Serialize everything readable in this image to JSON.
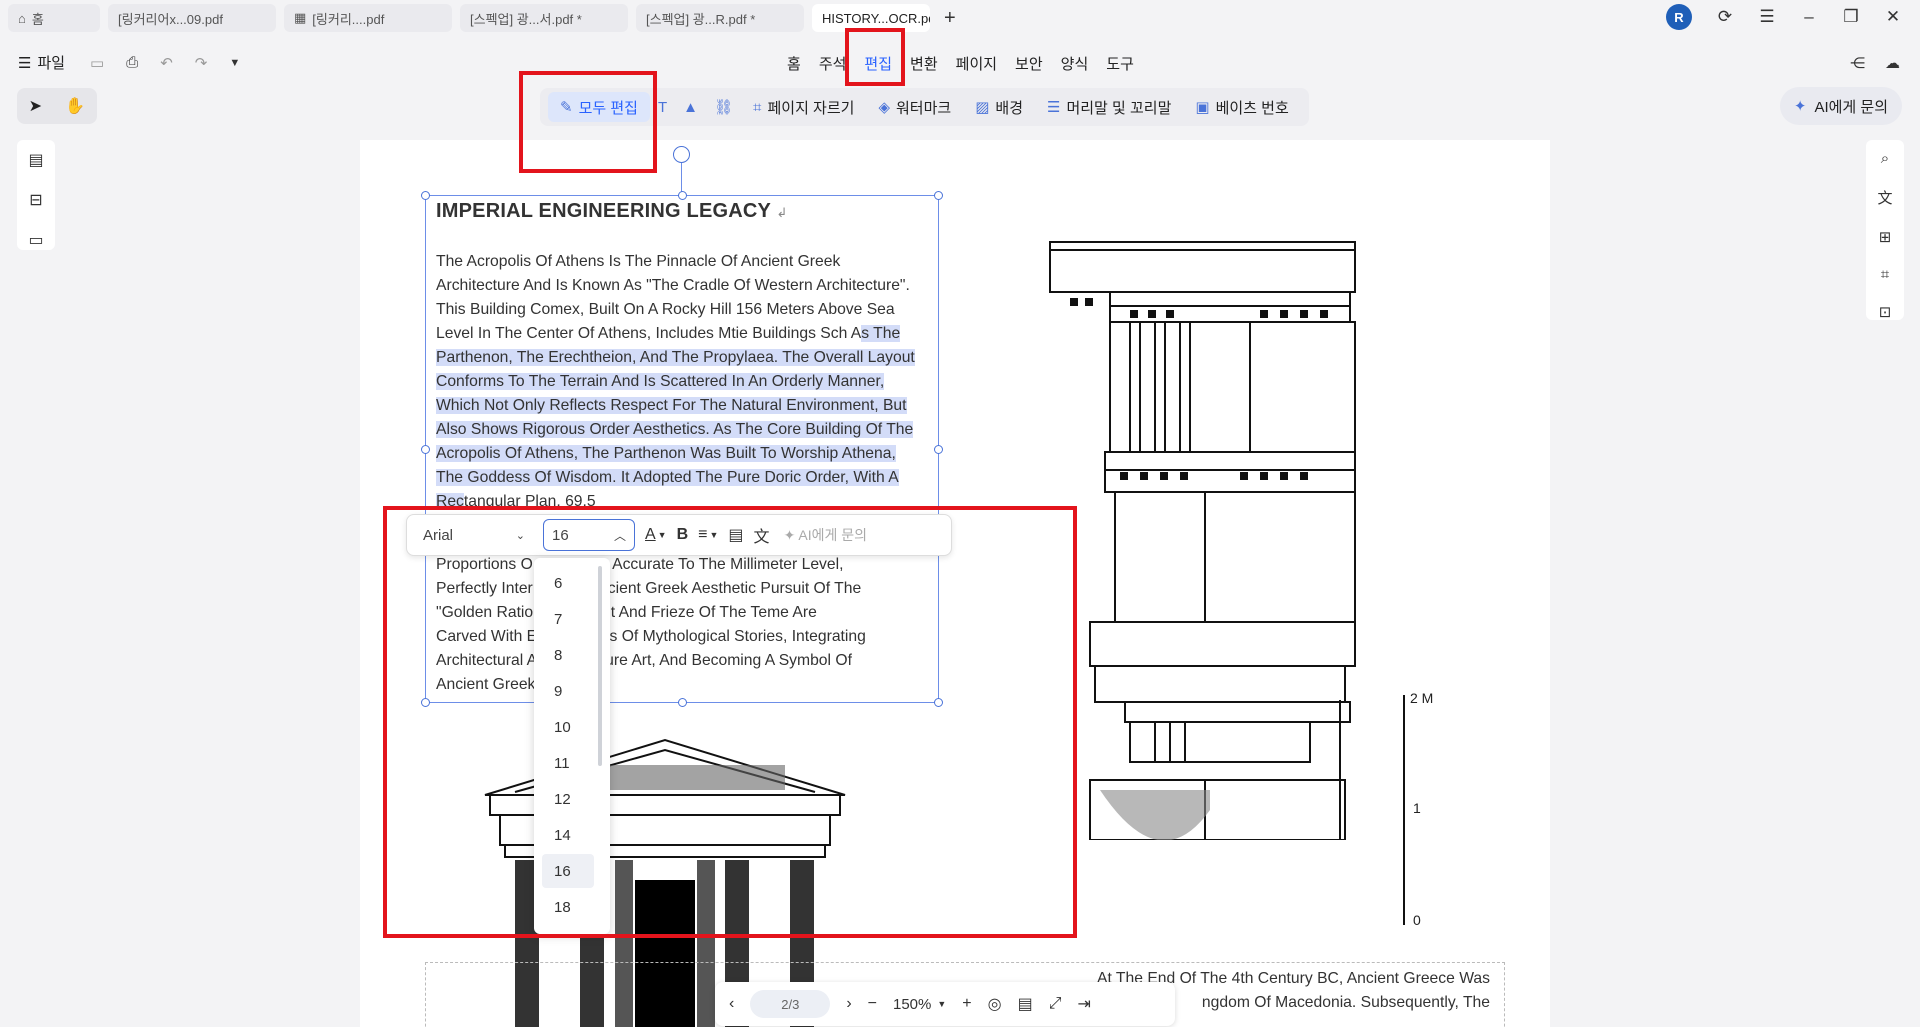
{
  "tabs": {
    "home": "홈",
    "items": [
      "[링커리어x...09.pdf",
      "[링커리....pdf",
      "[스펙업] 광...서.pdf *",
      "[스펙업] 광...R.pdf *",
      "HISTORY...OCR.pdf"
    ],
    "active_index": 4,
    "close": "×",
    "add": "+"
  },
  "window": {
    "avatar": "R"
  },
  "menubar": {
    "file": "파일",
    "items": [
      "홈",
      "주석",
      "편집",
      "변환",
      "페이지",
      "보안",
      "양식",
      "도구"
    ],
    "active": "편집"
  },
  "toolbar": {
    "edit_all": "모두 편집",
    "crop": "페이지 자르기",
    "watermark": "워터마크",
    "background": "배경",
    "header_footer": "머리말 및 꼬리말",
    "bates": "베이츠 번호",
    "ai": "AI에게 문의"
  },
  "document": {
    "title": "IMPERIAL ENGINEERING LEGACY",
    "para_before": "The Acropolis Of Athens Is The Pinnacle Of Ancient Greek Architecture And Is Known As \"The Cradle Of Western Architecture\". This Building Com⁠ex, Built On A Rocky Hill 156 Meters Above Sea Level In The Center Of Athens, Includes M⁠ti⁠e Buildings S⁠ch A",
    "para_highlight": "s The Parthenon, The Erechtheion, And The Propylaea. The Overall Layout Conforms To The Terrain And Is Scattered In An Orderly Manner, Which Not Only Reflects Respect For The Natural Environment, But Also Shows Rigorous Order Aesthetics. As The Core Building Of The Acropolis Of Athens, The Parthenon Was Built To Worship Athena, The Goddess Of Wisdom. It Adopted The Pure Doric Order, With A Rec",
    "para_after": "tangular Plan, 69.5",
    "para2_lines": [
      "Proportions O          t Are Accurate To The Millimeter Level,",
      "Perfectly Inter          e Ancient Greek Aesthetic Pursuit Of The",
      "\"Golden Ratio          iment And Frieze Of The Tem⁠e Are",
      "Carved With E          eliefs Of Mythological Stories, Integrating",
      "Architectural A          ulpture Art, And Becoming A Symbol Of",
      "Ancient Greek          n."
    ],
    "bottom_lines": [
      "At The End Of The 4th Century BC, Ancient Greece Was",
      "ngdom Of Macedonia. Subsequently, The"
    ],
    "scale_labels": [
      "2 M",
      "1",
      "0"
    ]
  },
  "text_toolbar": {
    "font": "Arial",
    "size": "16",
    "ai": "AI에게 문의"
  },
  "size_options": [
    "6",
    "7",
    "8",
    "9",
    "10",
    "11",
    "12",
    "14",
    "16",
    "18"
  ],
  "selected_size": "16",
  "nav": {
    "page": "2/3",
    "zoom": "150%"
  },
  "colors": {
    "accent": "#2962ff",
    "annotation_red": "#e3141c",
    "highlight": "#d3dcf8"
  }
}
